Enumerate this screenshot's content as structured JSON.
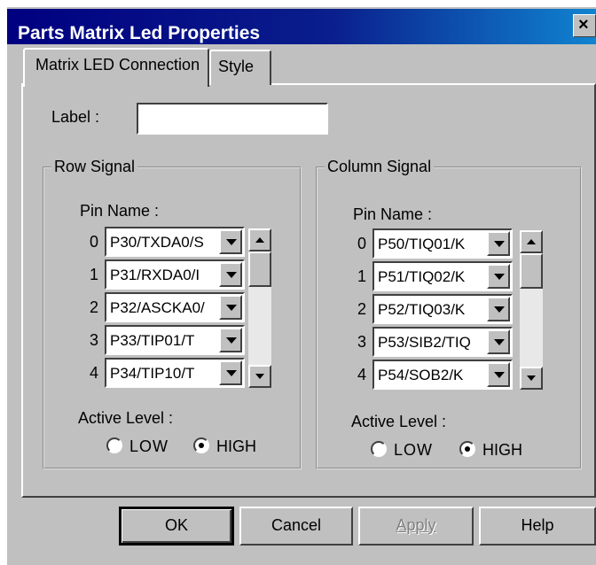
{
  "dialog": {
    "title": "Parts Matrix Led Properties",
    "close_glyph": "×"
  },
  "tabs": [
    {
      "label": "Matrix LED Connection",
      "active": true
    },
    {
      "label": "Style",
      "active": false
    }
  ],
  "label_field": {
    "label": "Label :",
    "value": ""
  },
  "row_signal": {
    "title": "Row Signal",
    "pin_name_label": "Pin Name :",
    "rows": [
      {
        "index": "0",
        "value": "P30/TXDA0/S"
      },
      {
        "index": "1",
        "value": "P31/RXDA0/I"
      },
      {
        "index": "2",
        "value": "P32/ASCKA0/"
      },
      {
        "index": "3",
        "value": "P33/TIP01/T"
      },
      {
        "index": "4",
        "value": "P34/TIP10/T"
      }
    ],
    "active_level_label": "Active Level :",
    "low_label": "LOW",
    "high_label": "HIGH",
    "selected": "HIGH"
  },
  "column_signal": {
    "title": "Column Signal",
    "pin_name_label": "Pin Name :",
    "rows": [
      {
        "index": "0",
        "value": "P50/TIQ01/K"
      },
      {
        "index": "1",
        "value": "P51/TIQ02/K"
      },
      {
        "index": "2",
        "value": "P52/TIQ03/K"
      },
      {
        "index": "3",
        "value": "P53/SIB2/TIQ"
      },
      {
        "index": "4",
        "value": "P54/SOB2/K"
      }
    ],
    "active_level_label": "Active Level :",
    "low_label": "LOW",
    "high_label": "HIGH",
    "selected": "HIGH"
  },
  "buttons": {
    "ok": "OK",
    "cancel": "Cancel",
    "apply": "Apply",
    "help": "Help"
  },
  "colors": {
    "title_start": "#000080",
    "title_end": "#1084d0",
    "face": "#c0c0c0"
  }
}
